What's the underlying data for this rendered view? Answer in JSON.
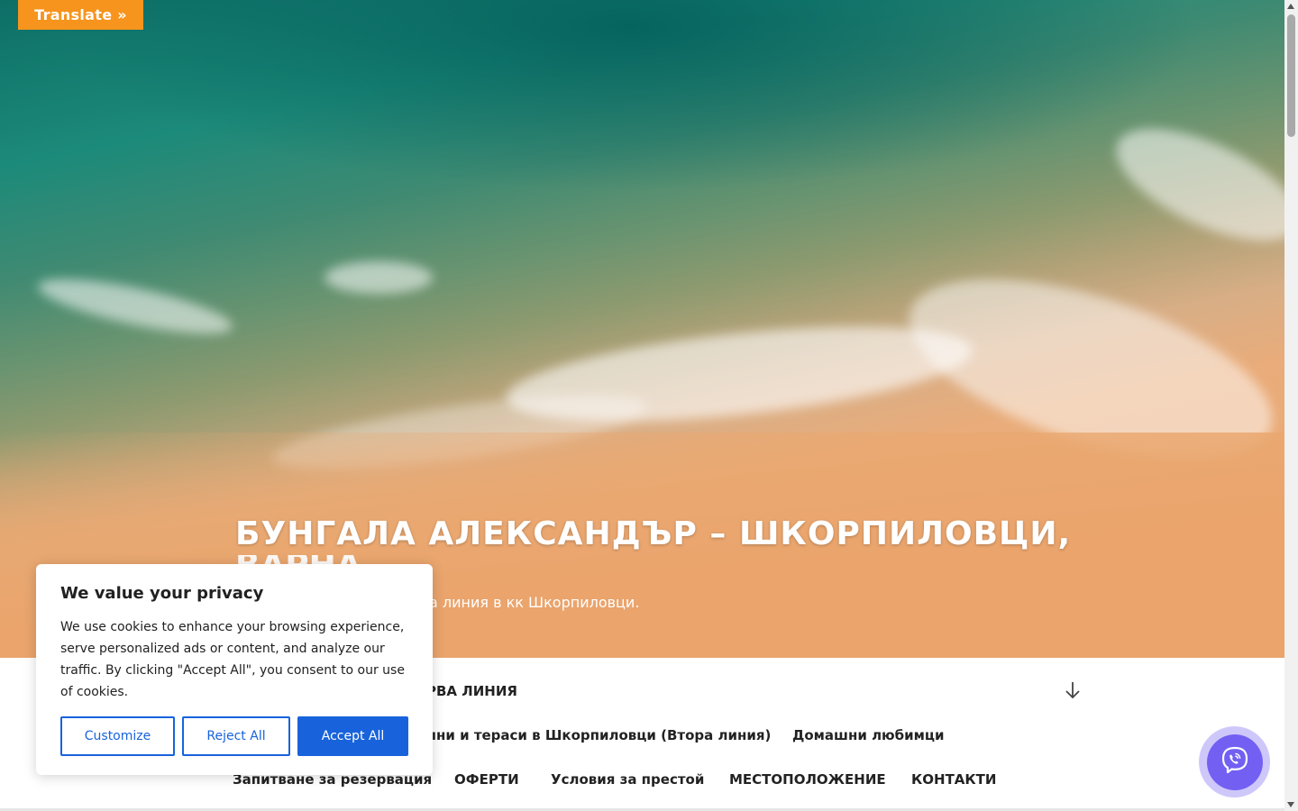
{
  "translate": {
    "label": "Translate »"
  },
  "hero": {
    "title": "БУНГАЛА АЛЕКСАНДЪР – ШКОРПИЛОВЦИ,",
    "title_overflow": "ВАРНА",
    "subtitle_visible": "а линия в кк Шкорпиловци."
  },
  "nav": {
    "row1": [
      {
        "label": "РВА ЛИНИЯ"
      }
    ],
    "row2": [
      {
        "label": "лни и тераси в Шкорпиловци (Втора линия)"
      },
      {
        "label": "Домашни любимци"
      }
    ],
    "row3": [
      {
        "label": "Запитване за резервация"
      },
      {
        "label": "ОФЕРТИ"
      },
      {
        "label": "Условия за престой"
      },
      {
        "label": "МЕСТОПОЛОЖЕНИЕ"
      },
      {
        "label": "КОНТАКТИ"
      }
    ]
  },
  "cookie": {
    "title": "We value your privacy",
    "text": "We use cookies to enhance your browsing experience, serve personalized ads or content, and analyze our traffic. By clicking \"Accept All\", you consent to our use of cookies.",
    "customize": "Customize",
    "reject": "Reject All",
    "accept": "Accept All"
  },
  "icons": {
    "scroll_down": "arrow-down-icon",
    "viber": "viber-phone-icon"
  },
  "colors": {
    "translate_bg": "#f7941d",
    "cookie_primary": "#1863dc",
    "viber": "#7360f2",
    "nav_text": "#222222"
  }
}
